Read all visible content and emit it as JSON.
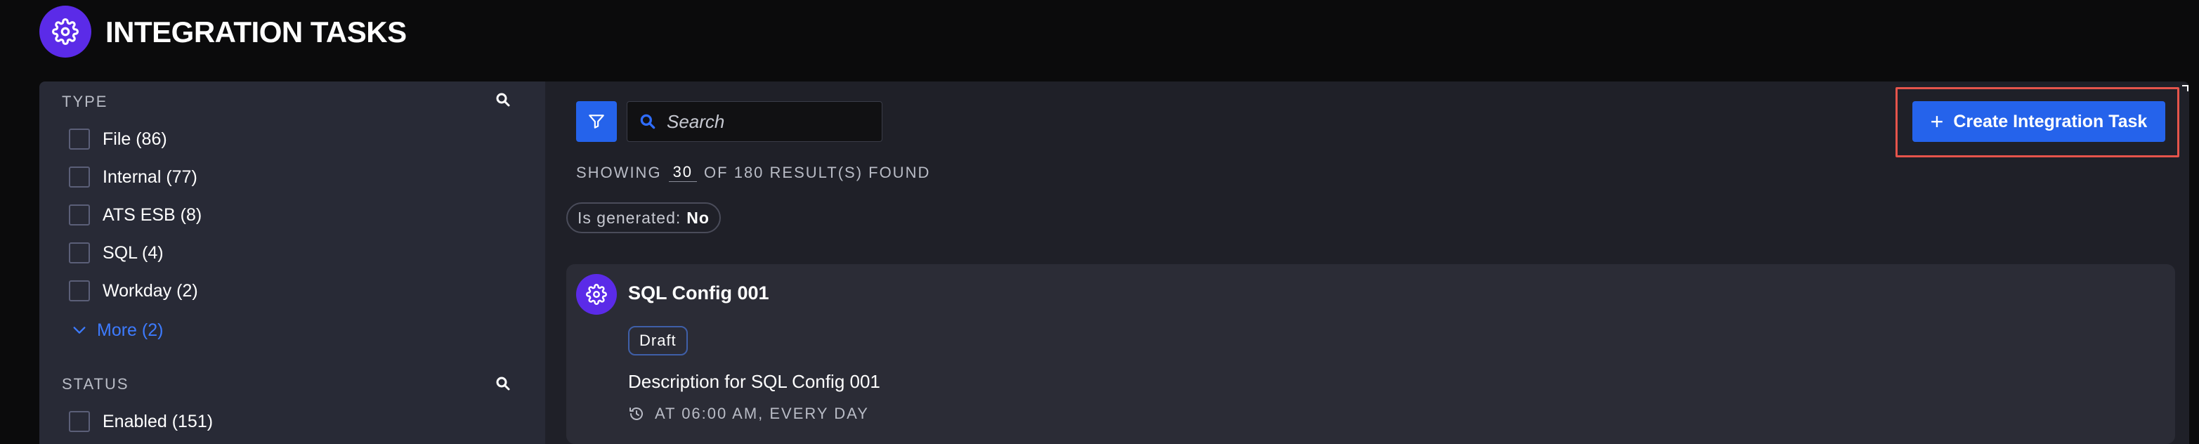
{
  "header": {
    "title": "INTEGRATION TASKS",
    "icon": "gear-icon",
    "icon_color": "#5b2be8"
  },
  "sidebar": {
    "type_facet": {
      "heading": "TYPE",
      "items": [
        {
          "label": "File (86)"
        },
        {
          "label": "Internal (77)"
        },
        {
          "label": "ATS ESB (8)"
        },
        {
          "label": "SQL (4)"
        },
        {
          "label": "Workday (2)"
        }
      ],
      "more_label": "More (2)"
    },
    "status_facet": {
      "heading": "STATUS",
      "items": [
        {
          "label": "Enabled (151)"
        }
      ]
    }
  },
  "toolbar": {
    "search_placeholder": "Search",
    "create_label": "Create Integration Task",
    "accent": "#2563eb",
    "highlight": "#e5544b"
  },
  "results": {
    "prefix": "SHOWING",
    "page_size": "30",
    "suffix": "OF 180 RESULT(S) FOUND"
  },
  "active_filter": {
    "key": "Is generated:",
    "value": "No"
  },
  "tasks": [
    {
      "title": "SQL Config 001",
      "status": "Draft",
      "description": "Description for SQL Config 001",
      "schedule": "AT 06:00 AM, EVERY DAY"
    }
  ]
}
